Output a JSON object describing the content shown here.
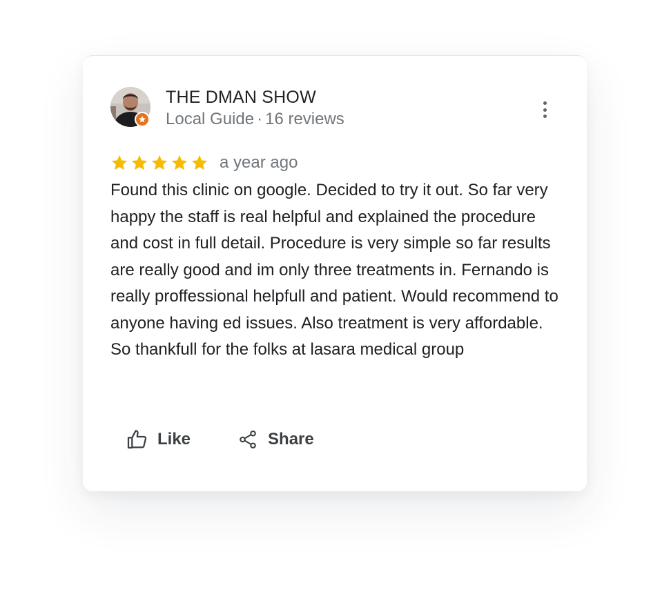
{
  "review": {
    "author": {
      "name": "THE DMAN SHOW",
      "badge": "Local Guide",
      "separator": "·",
      "reviews_count": "16 reviews",
      "avatar_icon": "user-avatar-photo",
      "badge_icon": "local-guide-star-icon"
    },
    "rating": {
      "stars": 5,
      "max": 5,
      "color": "#f6bb06"
    },
    "date": "a year ago",
    "text": "Found this clinic on google. Decided to try it out. So far very happy the staff is real helpful and explained the procedure and cost in full detail. Procedure is very simple so far results are really good and im only three treatments in. Fernando is really proffessional helpfull and patient. Would recommend to anyone having ed issues. Also treatment is very affordable. So thankfull for the folks at lasara medical group",
    "actions": {
      "like_label": "Like",
      "like_icon": "thumbs-up-icon",
      "share_label": "Share",
      "share_icon": "share-icon"
    },
    "more_icon": "more-vertical-icon"
  },
  "colors": {
    "badge": "#e8711a",
    "text_primary": "#202124",
    "text_secondary": "#70757a",
    "icon": "#5f6368"
  }
}
